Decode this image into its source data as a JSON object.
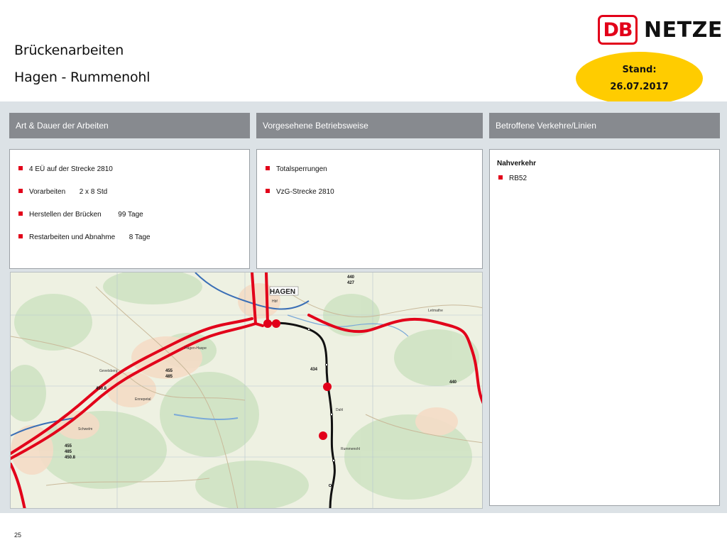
{
  "header": {
    "title_line1": "Brückenarbeiten",
    "title_line2": "Hagen - Rummenohl",
    "logo": {
      "db": "DB",
      "netze": "NETZE"
    },
    "stand_label": "Stand:",
    "stand_date": "26.07.2017"
  },
  "columns": {
    "col1_header": "Art & Dauer der Arbeiten",
    "col2_header": "Vorgesehene Betriebsweise",
    "col3_header": "Betroffene Verkehre/Linien"
  },
  "works": [
    {
      "text": "4 EÜ auf der Strecke 2810"
    },
    {
      "label": "Vorarbeiten",
      "value": "2 x 8 Std"
    },
    {
      "label": "Herstellen der Brücken",
      "value": "99 Tage"
    },
    {
      "label": "Restarbeiten und Abnahme",
      "value": "8 Tage"
    }
  ],
  "operation": [
    {
      "text": "Totalsperrungen"
    },
    {
      "text": "VzG-Strecke 2810"
    }
  ],
  "traffic": {
    "category": "Nahverkehr",
    "lines": [
      "RB52"
    ]
  },
  "map": {
    "labels": {
      "hagen": "HAGEN",
      "hagen_hbf": "Hbf",
      "rummenohl": "Rummenohl",
      "dahl": "Dahl",
      "schwelm": "Schwelm",
      "ennepetal": "Ennepetal",
      "haspe": "Hagen-Haspe",
      "gevelsberg": "Gevelsberg",
      "letmathe": "Letmathe",
      "n434": "434",
      "n440a": "440",
      "n427": "427",
      "n440b": "440",
      "n455a": "455",
      "n485a": "485",
      "n4508a": "450.8",
      "n455b": "455",
      "n485b": "485",
      "n4508b": "450.8"
    },
    "colors": {
      "main_line": "#e2001a",
      "affected_line": "#111111",
      "marker": "#e2001a"
    }
  },
  "footer": {
    "page_number": "25"
  }
}
